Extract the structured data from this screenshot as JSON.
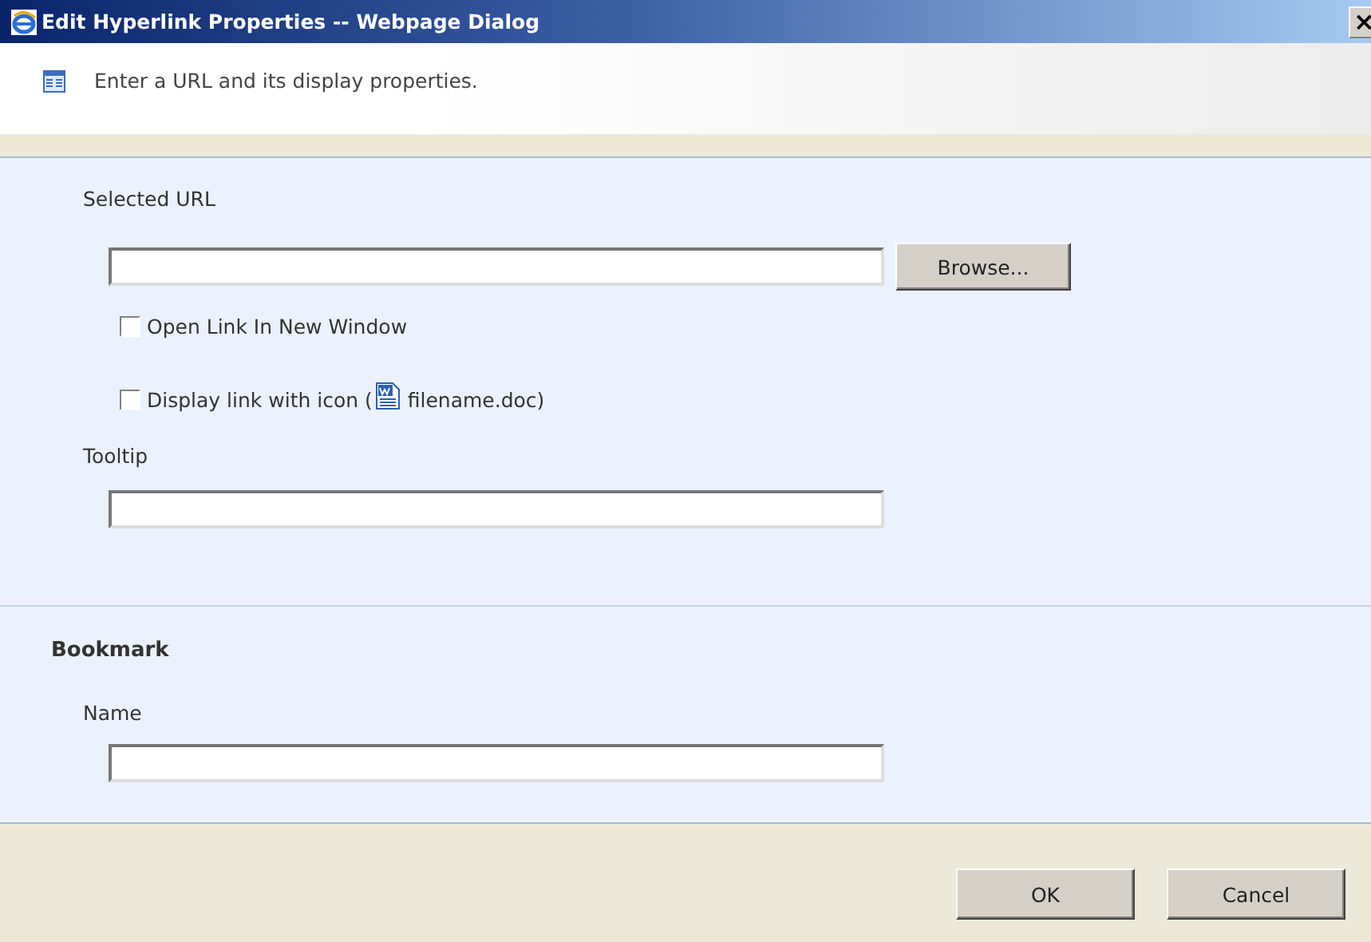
{
  "window": {
    "title": "Edit Hyperlink Properties -- Webpage Dialog",
    "close": "×"
  },
  "header": {
    "text": "Enter a URL and its display properties."
  },
  "url_section": {
    "label": "Selected URL",
    "browse": "Browse...",
    "options": [
      {
        "label": "Open Link In New Window",
        "checked": false,
        "kind": "plain"
      },
      {
        "label": "Display link with icon (",
        "suffix": "filename.doc)",
        "checked": false,
        "kind": "icon"
      }
    ],
    "tooltip_label": "Tooltip"
  },
  "bookmark": {
    "heading": "Bookmark",
    "name_label": "Name"
  },
  "buttons": [
    "OK",
    "Cancel"
  ]
}
